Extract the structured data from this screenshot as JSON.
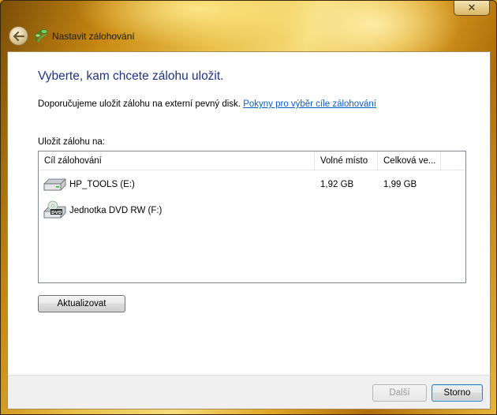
{
  "window": {
    "title": "Nastavit zálohování",
    "close_glyph": "✕"
  },
  "main": {
    "heading": "Vyberte, kam chcete zálohu uložit.",
    "recommendation": "Doporučujeme uložit zálohu na externí pevný disk.",
    "help_link": "Pokyny pro výběr cíle zálohování",
    "save_to_label": "Uložit zálohu na:",
    "list": {
      "columns": [
        "Cíl zálohování",
        "Volné místo",
        "Celková ve..."
      ],
      "rows": [
        {
          "icon": "hard-drive-icon",
          "name": "HP_TOOLS (E:)",
          "free": "1,92 GB",
          "total": "1,99 GB"
        },
        {
          "icon": "dvd-drive-icon",
          "name": "Jednotka DVD RW (F:)",
          "free": "",
          "total": ""
        }
      ]
    },
    "refresh_label": "Aktualizovat"
  },
  "footer": {
    "next_label": "Další",
    "cancel_label": "Storno"
  },
  "colors": {
    "heading": "#1e3287",
    "link": "#0b5fc4",
    "accent_frame": "#d9a21a"
  }
}
